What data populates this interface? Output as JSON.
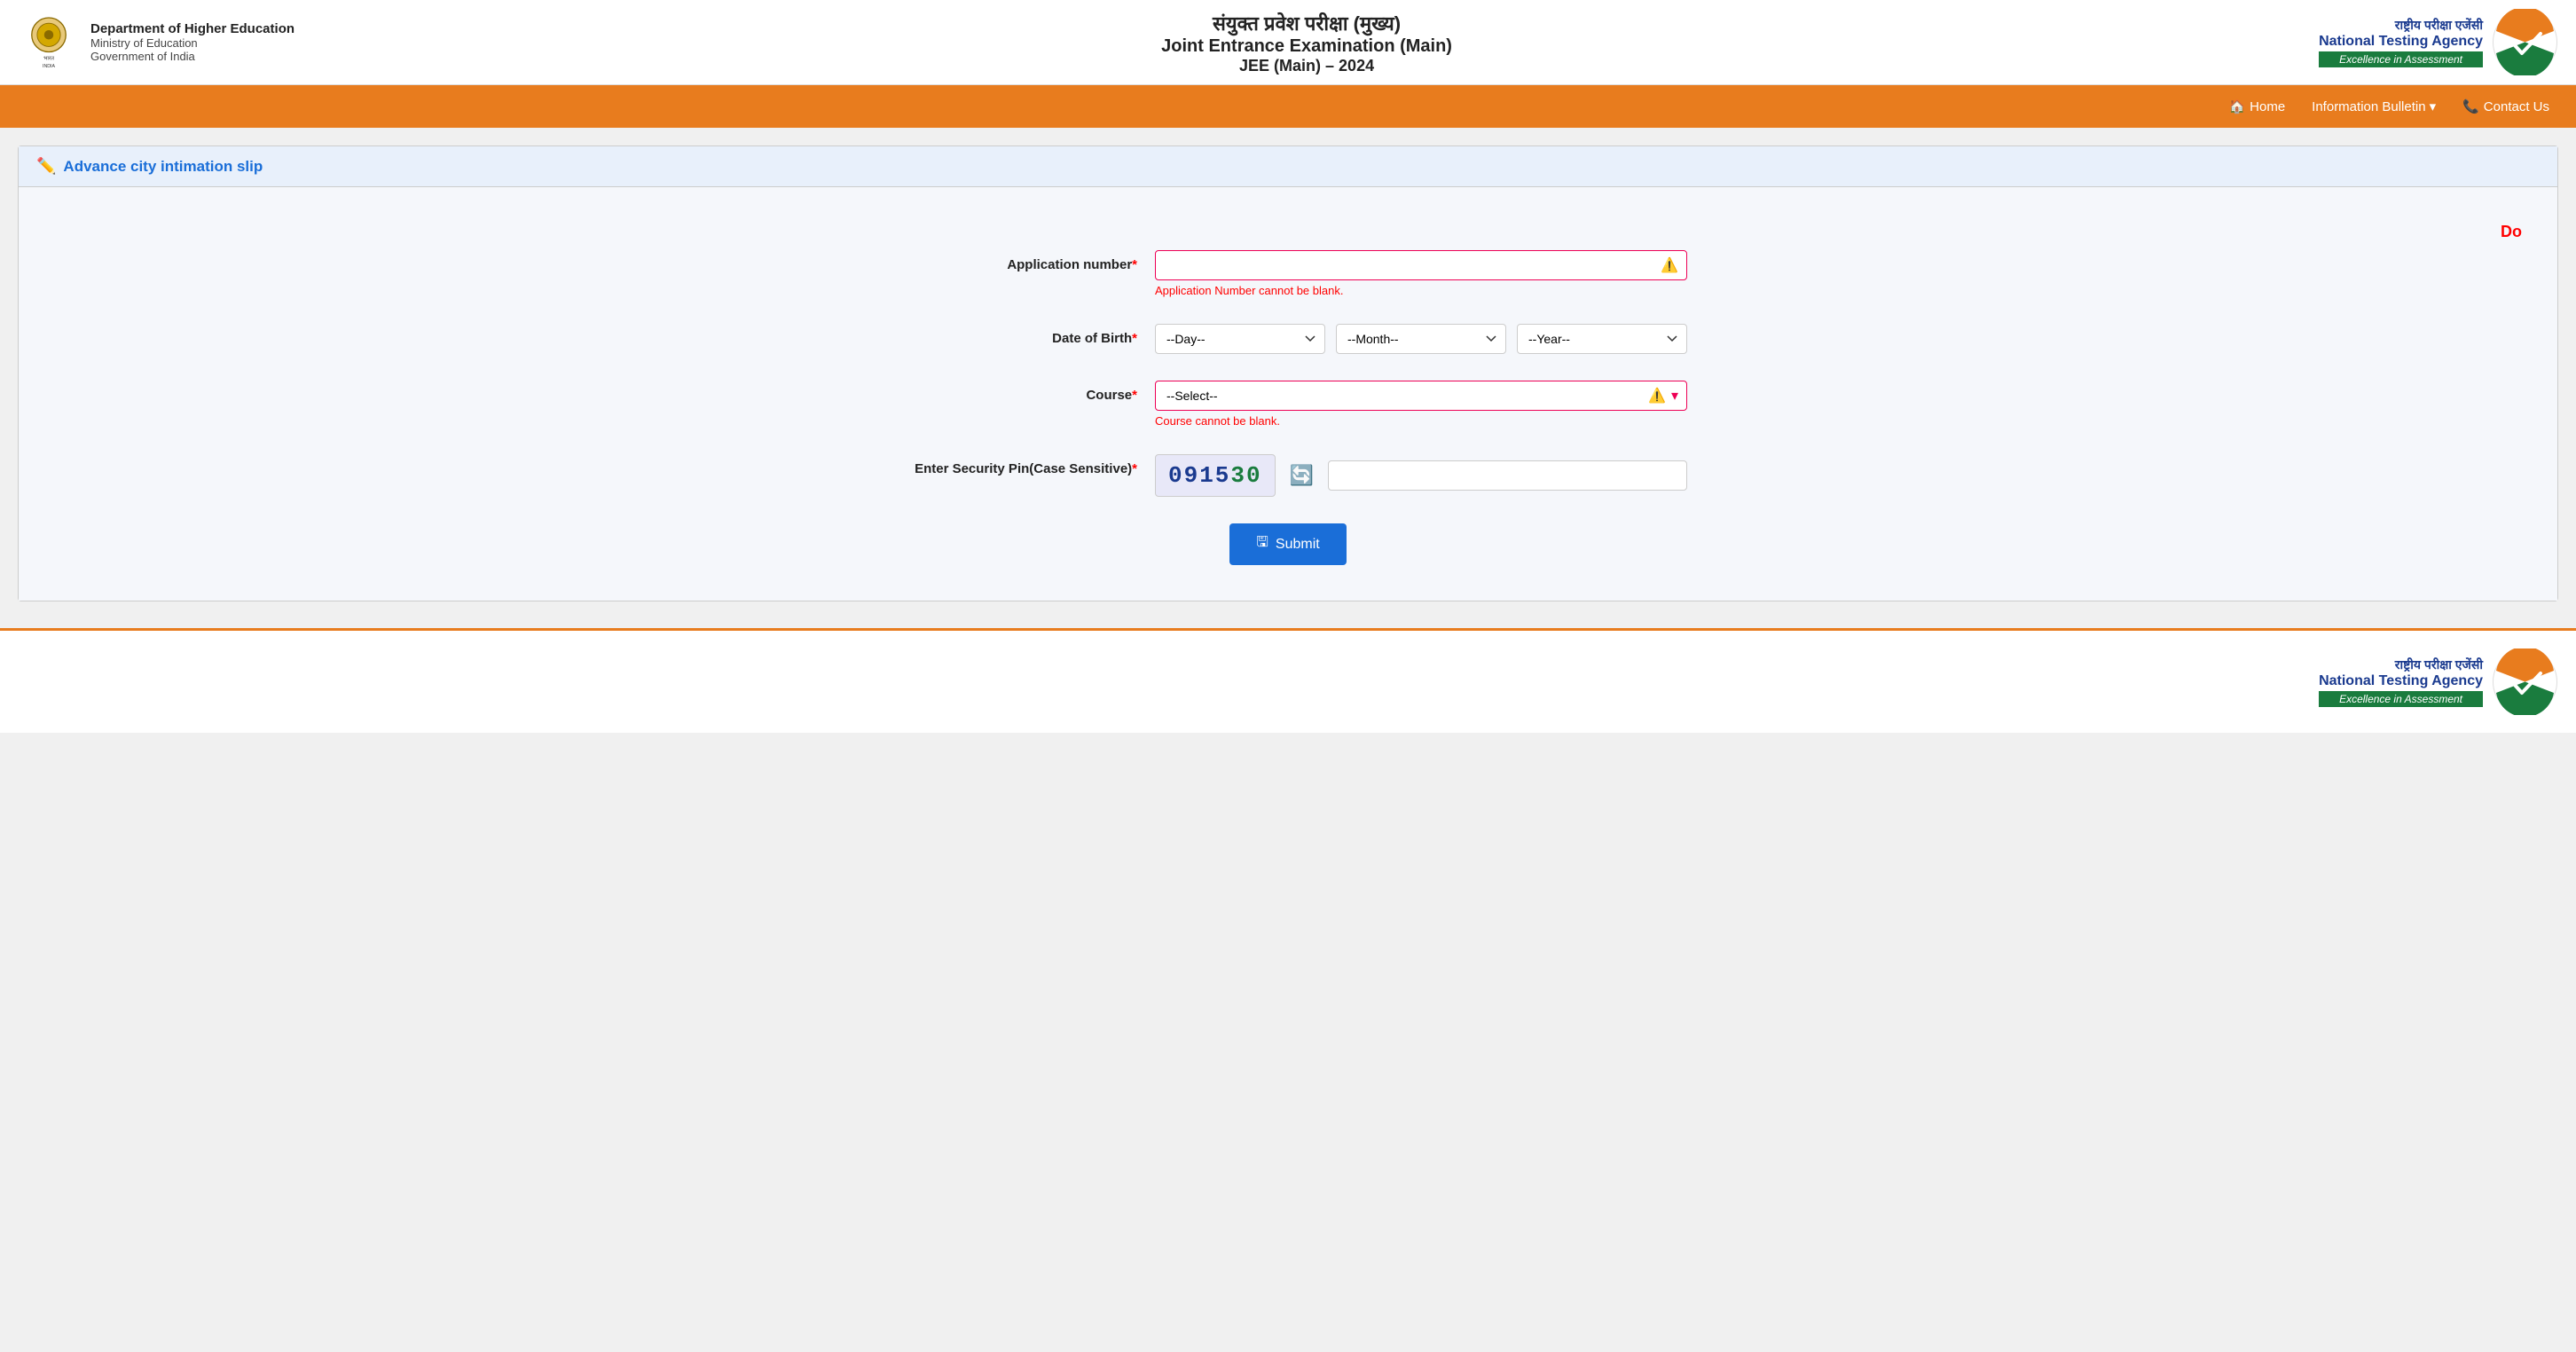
{
  "header": {
    "dept_name": "Department of Higher Education",
    "dept_ministry": "Ministry of Education",
    "dept_govt": "Government of India",
    "title_hindi": "संयुक्त प्रवेश परीक्षा (मुख्य)",
    "title_english": "Joint Entrance Examination (Main)",
    "title_year": "JEE (Main) – 2024",
    "nta_hindi": "राष्ट्रीय परीक्षा एजेंसी",
    "nta_english": "National Testing Agency",
    "nta_tagline": "Excellence in Assessment"
  },
  "navbar": {
    "home_label": "Home",
    "info_bulletin_label": "Information Bulletin",
    "contact_us_label": "Contact Us"
  },
  "form": {
    "section_title": "Advance city intimation slip",
    "do_label": "Do",
    "app_number_label": "Application number",
    "app_number_required": "*",
    "app_number_error": "Application Number cannot be blank.",
    "dob_label": "Date of Birth",
    "dob_required": "*",
    "dob_day_placeholder": "--Day--",
    "dob_month_placeholder": "--Month--",
    "dob_year_placeholder": "--Year--",
    "course_label": "Course",
    "course_required": "*",
    "course_placeholder": "--Select--",
    "course_error": "Course cannot be blank.",
    "security_label": "Enter Security Pin(Case Sensitive)",
    "security_required": "*",
    "captcha_text": "0915",
    "captcha_green": "30",
    "submit_label": "Submit"
  },
  "footer": {
    "nta_hindi": "राष्ट्रीय परीक्षा एजेंसी",
    "nta_english": "National Testing Agency",
    "nta_tagline": "Excellence in Assessment"
  }
}
